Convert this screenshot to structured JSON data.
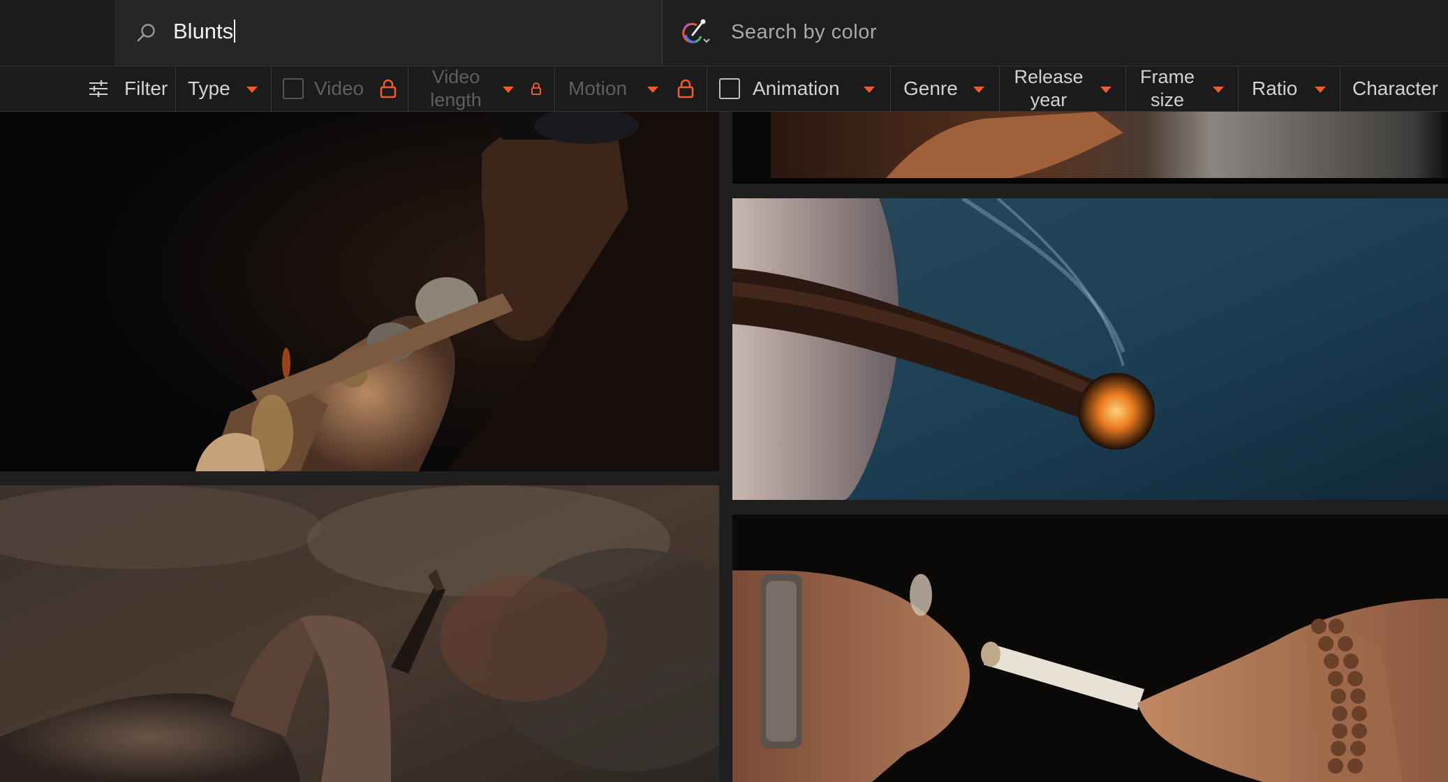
{
  "search": {
    "query": "Blunts",
    "color_placeholder": "Search by color",
    "icon": "search-icon",
    "color_icon": "color-picker-icon"
  },
  "filters": {
    "filter_label": "Filter",
    "type_label": "Type",
    "video_label": "Video",
    "video_length_label": "Video length",
    "motion_label": "Motion",
    "animation_label": "Animation",
    "genre_label": "Genre",
    "release_year_label": "Release year",
    "frame_size_label": "Frame size",
    "ratio_label": "Ratio",
    "character_label": "Character"
  },
  "colors": {
    "accent": "#ef5b2a",
    "background": "#1a1a1a",
    "disabled_text": "#5f5f5f"
  },
  "results": [
    {
      "icon": "image-thumbnail",
      "alt": ""
    },
    {
      "icon": "image-thumbnail",
      "alt": ""
    },
    {
      "icon": "image-thumbnail",
      "alt": ""
    },
    {
      "icon": "image-thumbnail",
      "alt": ""
    },
    {
      "icon": "image-thumbnail",
      "alt": ""
    }
  ]
}
